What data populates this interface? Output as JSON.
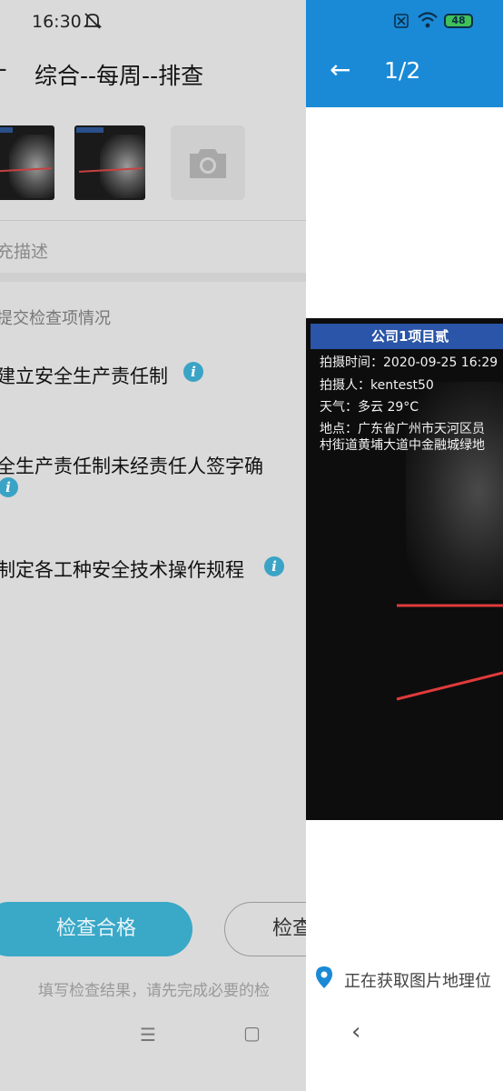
{
  "left": {
    "status_time": "16:30",
    "back_glyph": "←",
    "title": "综合--每周--排查",
    "description_placeholder": "充描述",
    "section_label": "提交检查项情况",
    "items": [
      {
        "text": "建立安全生产责任制"
      },
      {
        "text": "全生产责任制未经责任人签字确"
      },
      {
        "text": "制定各工种安全技术操作规程"
      }
    ],
    "pass_button": "检查合格",
    "fail_button": "检查",
    "hint": "填写检查结果，请先完成必要的检",
    "nav_menu_glyph": "☰",
    "nav_home_glyph": "▢"
  },
  "right": {
    "battery": "48",
    "page_indicator": "1/2",
    "back_glyph": "←",
    "photo": {
      "header": "公司1项目贰",
      "time_line": "拍摄时间：2020-09-25 16:29",
      "person_line": "拍摄人：kentest50",
      "weather_line": "天气：多云 29°C",
      "location_line1": "地点：广东省广州市天河区员",
      "location_line2": "村街道黄埔大道中金融城绿地"
    },
    "location_status": "正在获取图片地理位",
    "nav_back_glyph": "‹"
  },
  "colors": {
    "accent_blue": "#1a8ad6",
    "info_blue": "#3ba3c5",
    "pass_button": "#3aa8c7",
    "photo_header": "#2a55a8",
    "red_line": "#e03a3a"
  }
}
